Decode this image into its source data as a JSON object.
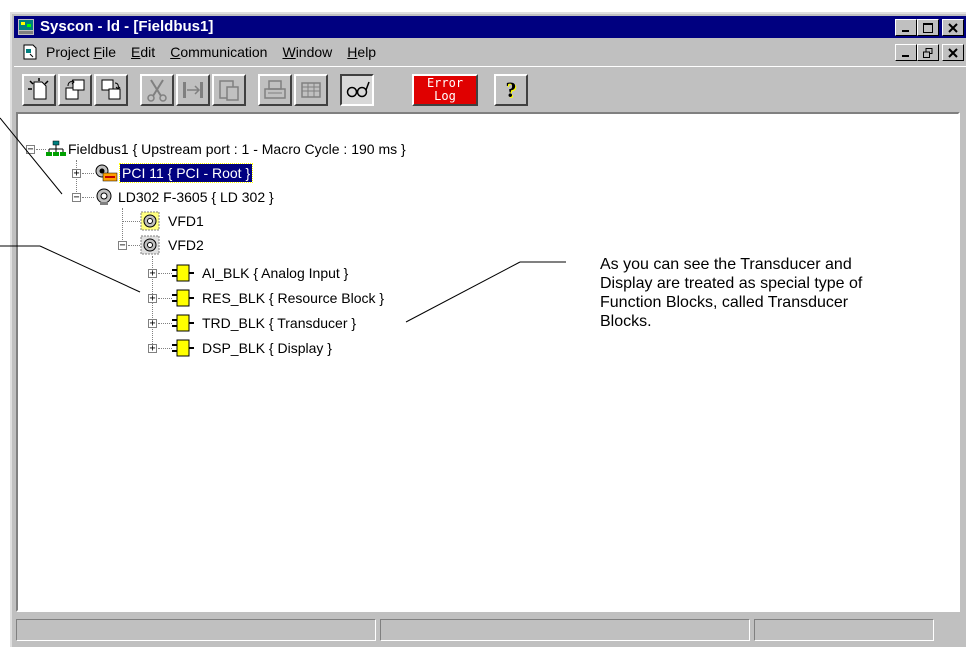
{
  "window": {
    "title": "Syscon - ld - [Fieldbus1]"
  },
  "menu": [
    {
      "label": "Project File",
      "accel_index": 8
    },
    {
      "label": "Edit",
      "accel_index": 0
    },
    {
      "label": "Communication",
      "accel_index": 0
    },
    {
      "label": "Window",
      "accel_index": 0
    },
    {
      "label": "Help",
      "accel_index": 0
    }
  ],
  "toolbar": {
    "buttons": [
      {
        "name": "new-icon"
      },
      {
        "name": "open-icon"
      },
      {
        "name": "save-icon"
      },
      {
        "name": "cut-icon"
      },
      {
        "name": "link-icon"
      },
      {
        "name": "paste-icon"
      },
      {
        "name": "print-icon"
      },
      {
        "name": "grid-icon"
      },
      {
        "name": "glasses-icon"
      },
      {
        "name": "error-log-button"
      },
      {
        "name": "help-icon"
      }
    ],
    "error_log_line1": "Error",
    "error_log_line2": "Log",
    "help_glyph": "?"
  },
  "tree": {
    "root": "Fieldbus1 { Upstream port : 1 -  Macro Cycle : 190 ms  }",
    "pci": "PCI 11 { PCI -  Root  }",
    "ld": "LD302 F-3605 { LD 302 }",
    "vfd1": "VFD1",
    "vfd2": "VFD2",
    "blocks": [
      "AI_BLK { Analog Input }",
      "RES_BLK { Resource Block }",
      "TRD_BLK { Transducer }",
      "DSP_BLK { Display }"
    ]
  },
  "annotation": {
    "text": "As you can see the Transducer and Display are treated as special type of Function Blocks, called Transducer Blocks."
  },
  "colors": {
    "titlebar": "#000080",
    "face": "#c0c0c0",
    "block_icon": "#ffff00",
    "error_log_bg": "#e00000"
  }
}
